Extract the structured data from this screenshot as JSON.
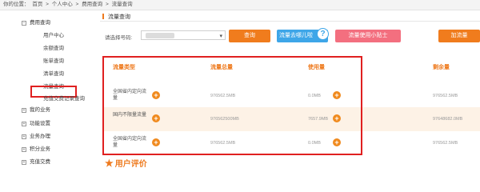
{
  "breadcrumb": {
    "prefix": "你的位置：",
    "home": "首页",
    "sep": ">",
    "personal": "个人中心",
    "fee": "费用查询",
    "current": "流量查询"
  },
  "sidebar": {
    "groups": [
      {
        "label": "费用查询",
        "toggle": "−"
      },
      {
        "label": "我的业务",
        "toggle": "+"
      },
      {
        "label": "功能设置",
        "toggle": "+"
      },
      {
        "label": "业务办理",
        "toggle": "+"
      },
      {
        "label": "积分业务",
        "toggle": "+"
      },
      {
        "label": "充值交费",
        "toggle": "+"
      }
    ],
    "items": [
      {
        "label": "用户中心"
      },
      {
        "label": "余额查询"
      },
      {
        "label": "账单查询"
      },
      {
        "label": "清单查询"
      },
      {
        "label": "流量查询"
      },
      {
        "label": "充值交费记录查询"
      }
    ]
  },
  "main": {
    "tab_title": "流量查询",
    "number_label": "请选择号码:",
    "select_arrow": "▾",
    "buttons": {
      "query": "查询",
      "where": "流量去哪儿啦",
      "where_icon": "?",
      "tips": "流量使用小贴士",
      "add": "加流量"
    },
    "table": {
      "headers": [
        "流量类型",
        "流量总量",
        "使用量",
        "剩余量"
      ],
      "rows": [
        {
          "type": "全国省内定向流量",
          "total": "976562.5MB",
          "used": "0.0MB",
          "remain": "976562.5MB"
        },
        {
          "type": "国内不限量流量",
          "total": "976562500MB",
          "used": "7657.9MB",
          "remain": "97648682.0MB"
        },
        {
          "type": "全国省内定向流量",
          "total": "976562.5MB",
          "used": "0.0MB",
          "remain": "976562.5MB"
        }
      ],
      "plus_symbol": "+"
    },
    "review_title": "用户评价",
    "review_icon": "★"
  }
}
